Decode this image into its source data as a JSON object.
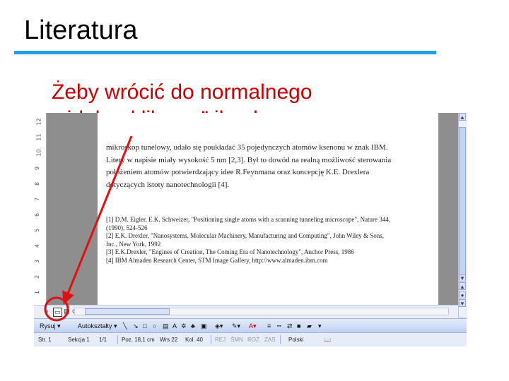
{
  "slide": {
    "title": "Literatura",
    "subtitle_line1": "Żeby wrócić do normalnego",
    "subtitle_line2": "widoku „klikamy” ikonkę",
    "accent_color": "#1aa3e8",
    "subtitle_color": "#cc0000",
    "annotation_color": "#e01010"
  },
  "document": {
    "lines": [
      "mikroskop tunelowy, udało się poukładać 35 pojedynczych atomów ksenonu w znak IBM.",
      "Litery w napisie miały wysokość 5 nm [2,3]. Był to dowód na realną możliwość sterowania",
      "położeniem atomów potwierdzający idee R.Feynmana oraz koncepcję K.E. Drexlera",
      "dotyczących istoty nanotechnologii [4]."
    ],
    "refs": [
      "[1] D.M. Eigler, E.K. Schweizer, \"Positioning single atoms with a scanning tunneling microscope\", Nature 344,",
      "(1990), 524-526",
      "[2] E.K. Drexler, \"Nanosystems, Molecular Machinery, Manufacturing and Computing\", John Wiley & Sons,",
      "Inc., New York, 1992",
      "[3] E.K.Drexler, \"Engines of Creation, The Coming Era of Nanotechnology\", Anchor Press, 1986",
      "[4] IBM Almaden Research Center, STM Image Gallery, http://www.almaden.ibm.com"
    ]
  },
  "ruler": {
    "marks": [
      "12",
      "11",
      "10",
      "9",
      "8",
      "7",
      "6",
      "5",
      "4",
      "3",
      "2",
      "1"
    ]
  },
  "drawing_toolbar": {
    "draw_label": "Rysuj",
    "autoshapes_label": "Autokształty"
  },
  "status_bar": {
    "page": "Str. 1",
    "section": "Sekcja 1",
    "page_of": "1/1",
    "position": "Poz. 18,1 cm",
    "line": "Wrs 22",
    "column": "Kol. 40",
    "rec": "REJ",
    "track": "ŚMN",
    "ext": "ROZ",
    "ovr": "ZAS",
    "language": "Polski"
  }
}
